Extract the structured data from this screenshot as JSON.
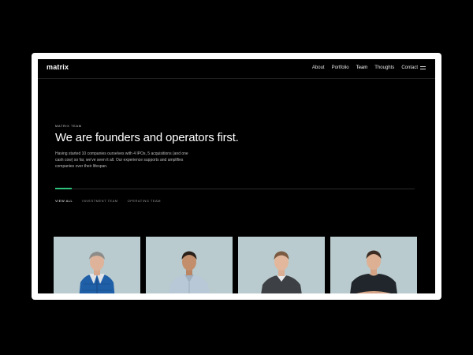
{
  "header": {
    "logo": "matrix",
    "nav": [
      "About",
      "Portfolio",
      "Team",
      "Thoughts",
      "Contact"
    ],
    "menu_icon": "hamburger-icon"
  },
  "hero": {
    "eyebrow": "MATRIX TEAM",
    "title": "We are founders and operators first.",
    "description": "Having started 10 companies ourselves with 4 IPOs, 5 acquisitions (and one cash cow) so far, we've seen it all. Our experience supports and amplifies companies over their lifespan."
  },
  "filters": [
    "VIEW ALL",
    "INVESTMENT TEAM",
    "OPERATING TEAM"
  ],
  "colors": {
    "accent": "#2ec27e",
    "card_background": "#b9cbce",
    "page_background": "#000000"
  }
}
